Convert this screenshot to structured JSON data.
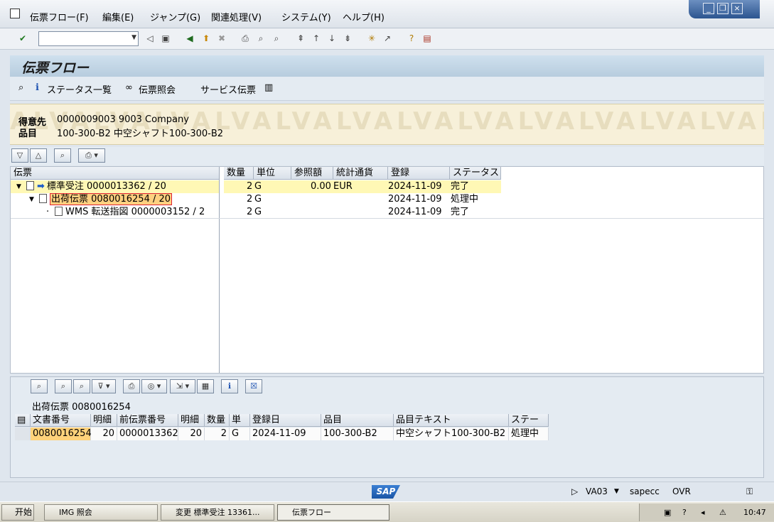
{
  "menu": [
    "伝票フロー(F)",
    "編集(E)",
    "ジャンプ(G)",
    "関連処理(V)",
    "システム(Y)",
    "ヘルプ(H)"
  ],
  "title": "伝票フロー",
  "app_toolbar": {
    "status_overview": "ステータス一覧",
    "doc_display": "伝票照会",
    "service_doc": "サービス伝票"
  },
  "header": {
    "customer_label": "得意先",
    "customer_value": "0000009003 9003 Company",
    "material_label": "品目",
    "material_value": "100-300-B2 中空シャフト100-300-B2",
    "watermark": "ALVALVALVALVALVALVALVALVALVALVALVALVALV"
  },
  "tree": {
    "headers": [
      "伝票",
      "数量",
      "単位",
      "参照額",
      "統計通貨",
      "登録",
      "ステータス"
    ],
    "rows": [
      {
        "doc": "標準受注 0000013362 / 20",
        "qty": "2",
        "unit": "G",
        "amount": "0.00",
        "currency": "EUR",
        "date": "2024-11-09",
        "status": "完了"
      },
      {
        "doc": "出荷伝票 0080016254 / 20",
        "qty": "2",
        "unit": "G",
        "amount": "",
        "currency": "",
        "date": "2024-11-09",
        "status": "処理中"
      },
      {
        "doc": "WMS 転送指図 0000003152 / 2",
        "qty": "2",
        "unit": "G",
        "amount": "",
        "currency": "",
        "date": "2024-11-09",
        "status": "完了"
      }
    ]
  },
  "grid": {
    "title": "出荷伝票 0080016254",
    "headers": [
      "文書番号",
      "明細",
      "前伝票番号",
      "明細",
      "数量",
      "単",
      "登録日",
      "品目",
      "品目テキスト",
      "ステー"
    ],
    "row": [
      "0080016254",
      "20",
      "0000013362",
      "20",
      "2",
      "G",
      "2024-11-09",
      "100-300-B2",
      "中空シャフト100-300-B2",
      "処理中"
    ]
  },
  "status": {
    "logo": "SAP",
    "tcode": "VA03",
    "system": "sapecc",
    "mode": "OVR"
  },
  "taskbar": {
    "start": "开始",
    "tasks": [
      "IMG 照会",
      "変更 標準受注 13361...",
      "伝票フロー"
    ],
    "clock": "10:47"
  }
}
